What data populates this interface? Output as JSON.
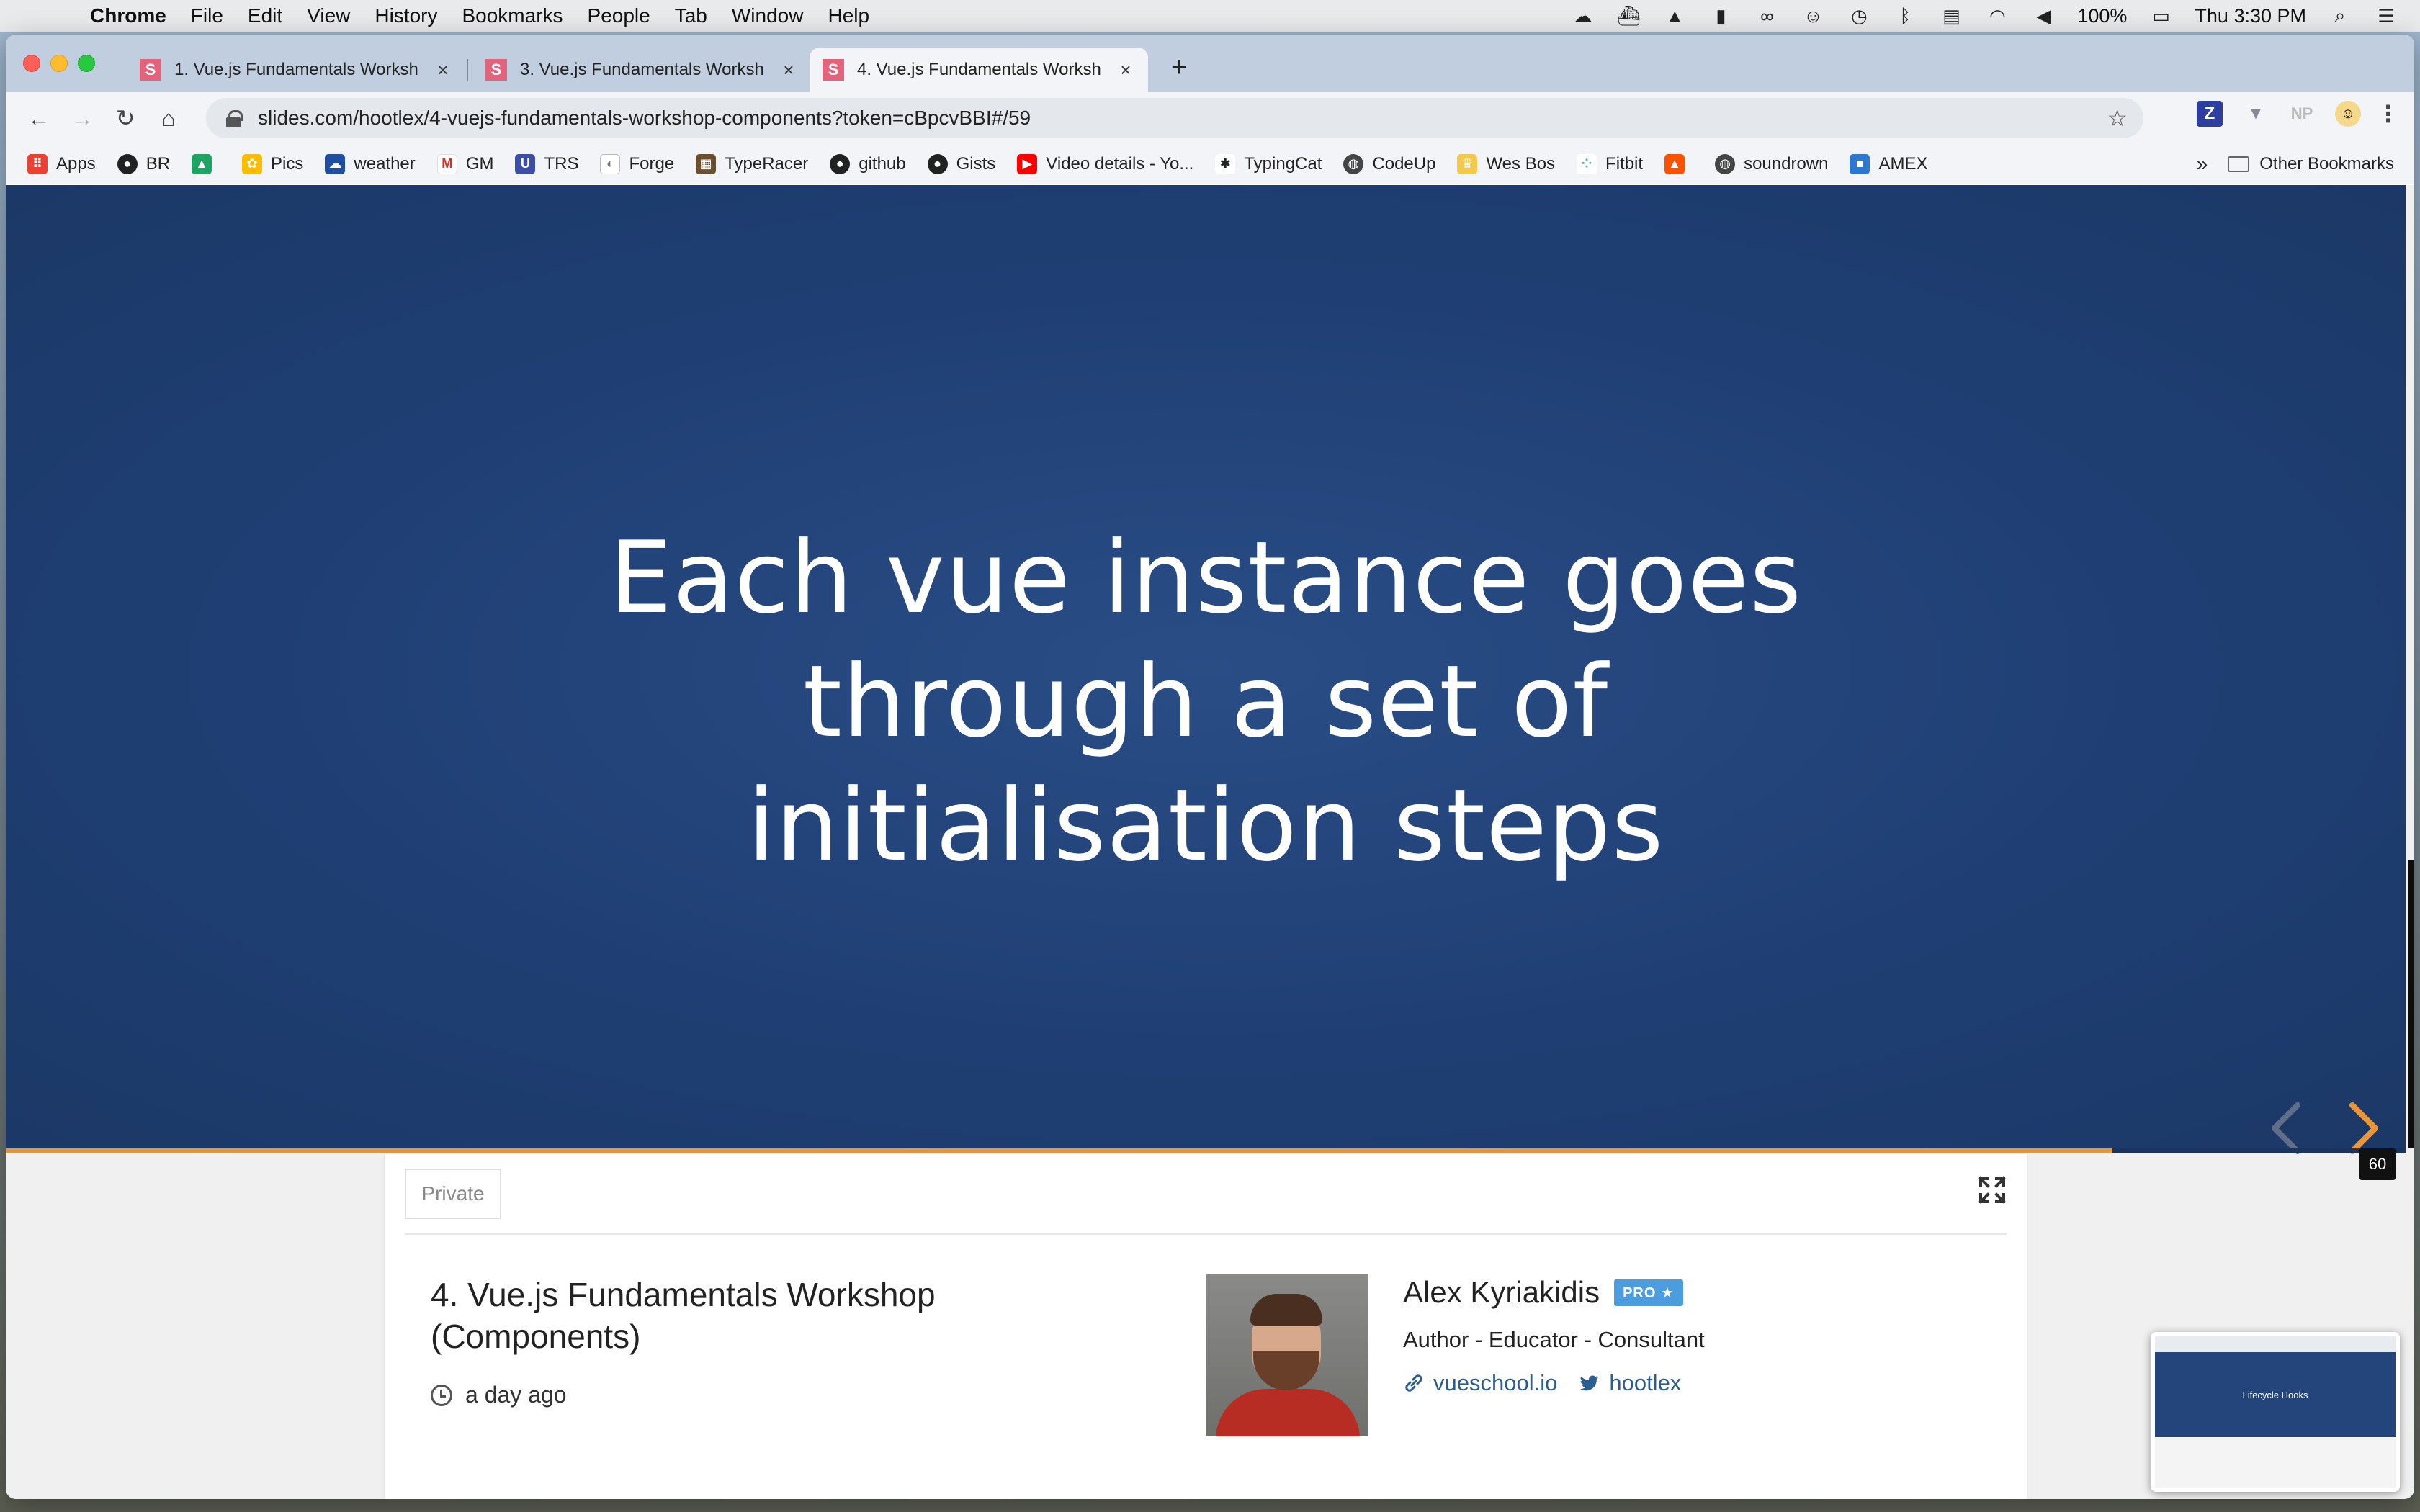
{
  "menubar": {
    "app_name": "Chrome",
    "items": [
      "File",
      "Edit",
      "View",
      "History",
      "Bookmarks",
      "People",
      "Tab",
      "Window",
      "Help"
    ],
    "battery": "100%",
    "clock": "Thu 3:30 PM"
  },
  "tabs": [
    {
      "title": "1. Vue.js Fundamentals Worksh",
      "favicon": "S"
    },
    {
      "title": "3. Vue.js Fundamentals Worksh",
      "favicon": "S"
    },
    {
      "title": "4. Vue.js Fundamentals Worksh",
      "favicon": "S",
      "active": true
    }
  ],
  "address_bar": {
    "url": "slides.com/hootlex/4-vuejs-fundamentals-workshop-components?token=cBpcvBBI#/59"
  },
  "extensions": {
    "z": "Z",
    "np": "NP"
  },
  "bookmarks": [
    {
      "label": "Apps",
      "icon": "apps-grid-icon",
      "color": "#e94235"
    },
    {
      "label": "BR",
      "icon": "github-icon",
      "color": "#222222"
    },
    {
      "label": "",
      "icon": "google-drive-icon",
      "color": "#1fa463"
    },
    {
      "label": "Pics",
      "icon": "google-photos-icon",
      "color": "#fbbc04"
    },
    {
      "label": "weather",
      "icon": "weather-channel-icon",
      "color": "#1e4fa1"
    },
    {
      "label": "GM",
      "icon": "gmail-icon",
      "color": "#d93025"
    },
    {
      "label": "TRS",
      "icon": "trs-icon",
      "color": "#3c4fa8"
    },
    {
      "label": "Forge",
      "icon": "forge-icon",
      "color": "#7a7a7a"
    },
    {
      "label": "TypeRacer",
      "icon": "typeracer-icon",
      "color": "#6b4e2e"
    },
    {
      "label": "github",
      "icon": "github-icon",
      "color": "#222222"
    },
    {
      "label": "Gists",
      "icon": "github-icon",
      "color": "#222222"
    },
    {
      "label": "Video details - Yo...",
      "icon": "youtube-icon",
      "color": "#ff0000"
    },
    {
      "label": "TypingCat",
      "icon": "paw-icon",
      "color": "#222222"
    },
    {
      "label": "CodeUp",
      "icon": "globe-icon",
      "color": "#444444"
    },
    {
      "label": "Wes Bos",
      "icon": "crown-icon",
      "color": "#f2c94c"
    },
    {
      "label": "Fitbit",
      "icon": "fitbit-icon",
      "color": "#3fb5b8"
    },
    {
      "label": "",
      "icon": "strava-icon",
      "color": "#fc5200"
    },
    {
      "label": "soundrown",
      "icon": "globe-icon",
      "color": "#444444"
    },
    {
      "label": "AMEX",
      "icon": "amex-icon",
      "color": "#2e77d0"
    }
  ],
  "bookmarks_overflow": "»",
  "other_bookmarks": "Other Bookmarks",
  "slide": {
    "title_lines": [
      "Each vue instance goes",
      "through a set of",
      "initialisation steps"
    ],
    "number": "60",
    "progress": 0.878,
    "background": "#1f3f74",
    "accent": "#e9963b"
  },
  "deck": {
    "visibility": "Private",
    "title": "4. Vue.js Fundamentals Workshop (Components)",
    "updated": "a day ago"
  },
  "author": {
    "name": "Alex Kyriakidis",
    "badge": "PRO ★",
    "role": "Author - Educator - Consultant",
    "website": "vueschool.io",
    "twitter": "hootlex"
  },
  "thumbnail": {
    "title": "Lifecycle Hooks"
  }
}
